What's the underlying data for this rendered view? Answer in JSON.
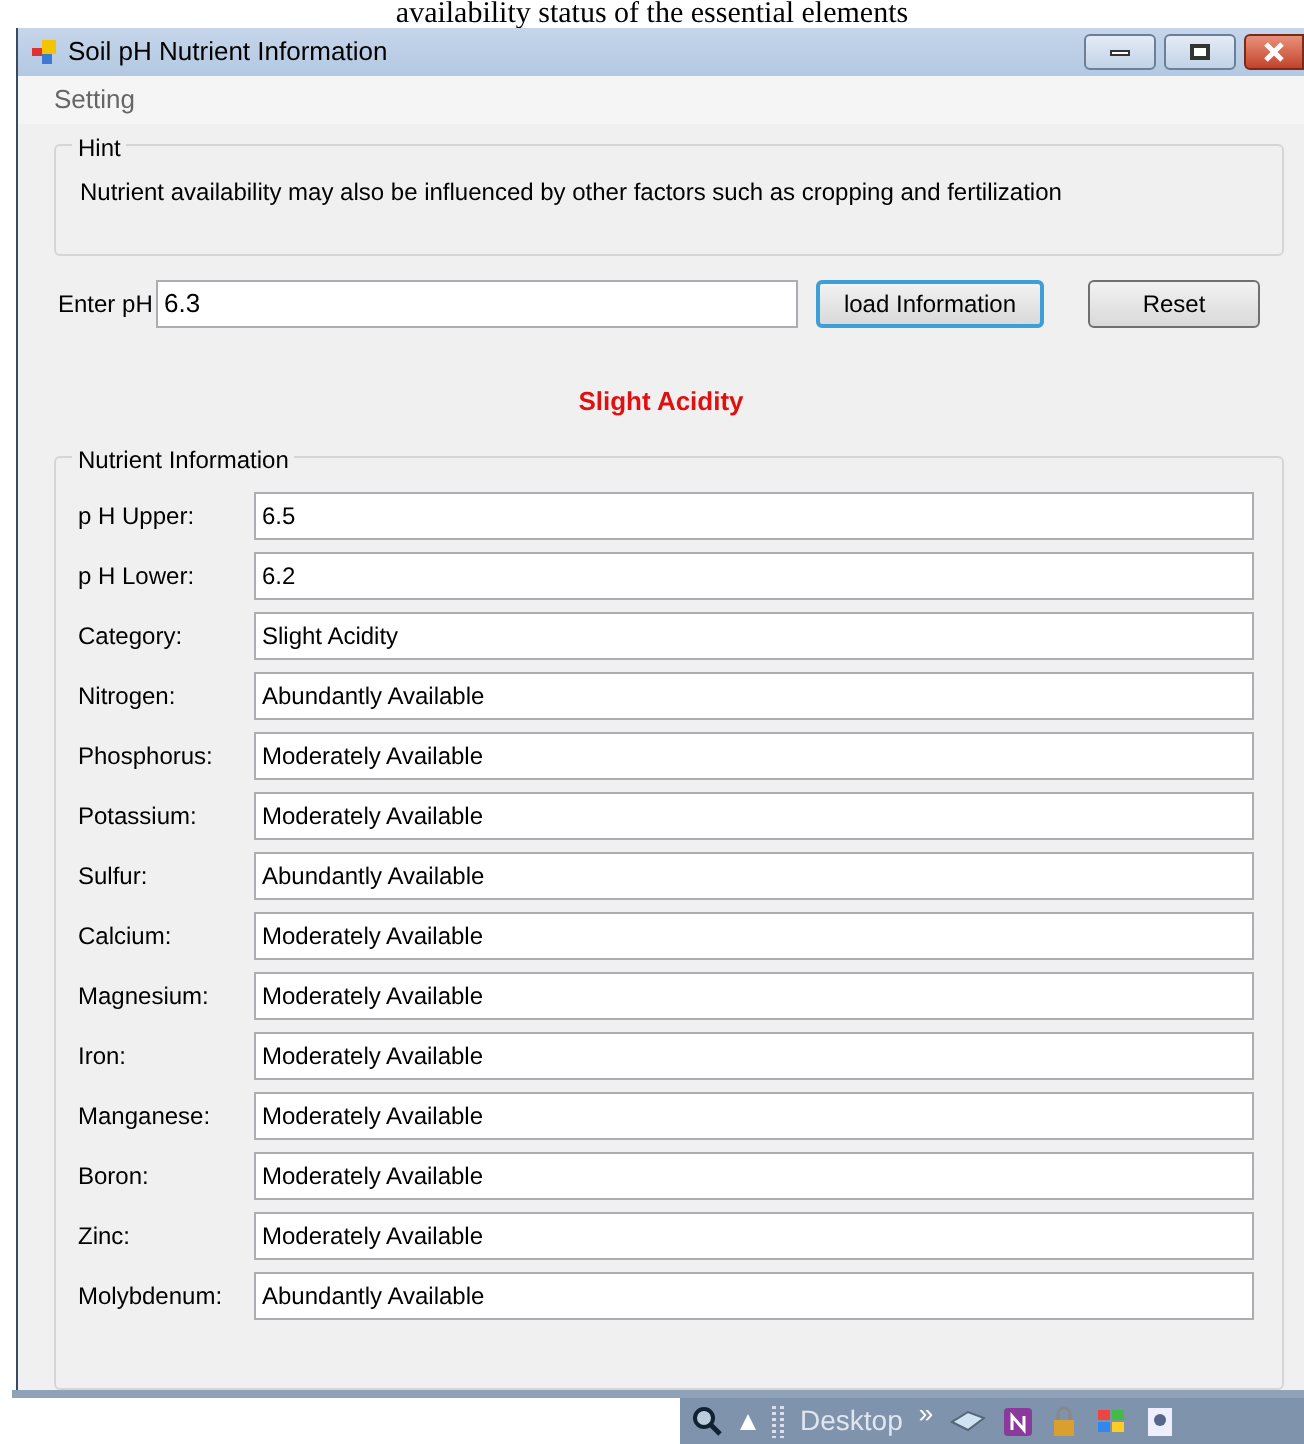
{
  "document_caption": "availability status of the essential elements",
  "window": {
    "title": "Soil pH Nutrient Information"
  },
  "menu": [
    "Setting"
  ],
  "hint": {
    "title": "Hint",
    "text": "Nutrient availability may also be influenced by other factors such as cropping and fertilization"
  },
  "ph_input": {
    "label": "Enter pH",
    "value": "6.3"
  },
  "buttons": [
    {
      "label": "load Information",
      "focused": true
    },
    {
      "label": "Reset",
      "focused": false
    }
  ],
  "result": "Slight Acidity",
  "nutrient_info": {
    "title": "Nutrient Information",
    "fields": [
      {
        "label": "p H Upper:",
        "value": "6.5"
      },
      {
        "label": "p H Lower:",
        "value": "6.2"
      },
      {
        "label": "Category:",
        "value": "Slight Acidity"
      },
      {
        "label": "Nitrogen:",
        "value": "Abundantly Available"
      },
      {
        "label": "Phosphorus:",
        "value": "Moderately Available"
      },
      {
        "label": "Potassium:",
        "value": "Moderately Available"
      },
      {
        "label": "Sulfur:",
        "value": "Abundantly Available"
      },
      {
        "label": "Calcium:",
        "value": "Moderately Available"
      },
      {
        "label": "Magnesium:",
        "value": "Moderately Available"
      },
      {
        "label": "Iron:",
        "value": "Moderately Available"
      },
      {
        "label": "Manganese:",
        "value": "Moderately Available"
      },
      {
        "label": "Boron:",
        "value": "Moderately Available"
      },
      {
        "label": "Zinc:",
        "value": "Moderately Available"
      },
      {
        "label": "Molybdenum:",
        "value": "Abundantly Available"
      }
    ]
  },
  "taskbar": {
    "toolbar_label": "Desktop",
    "chevron": "»"
  }
}
